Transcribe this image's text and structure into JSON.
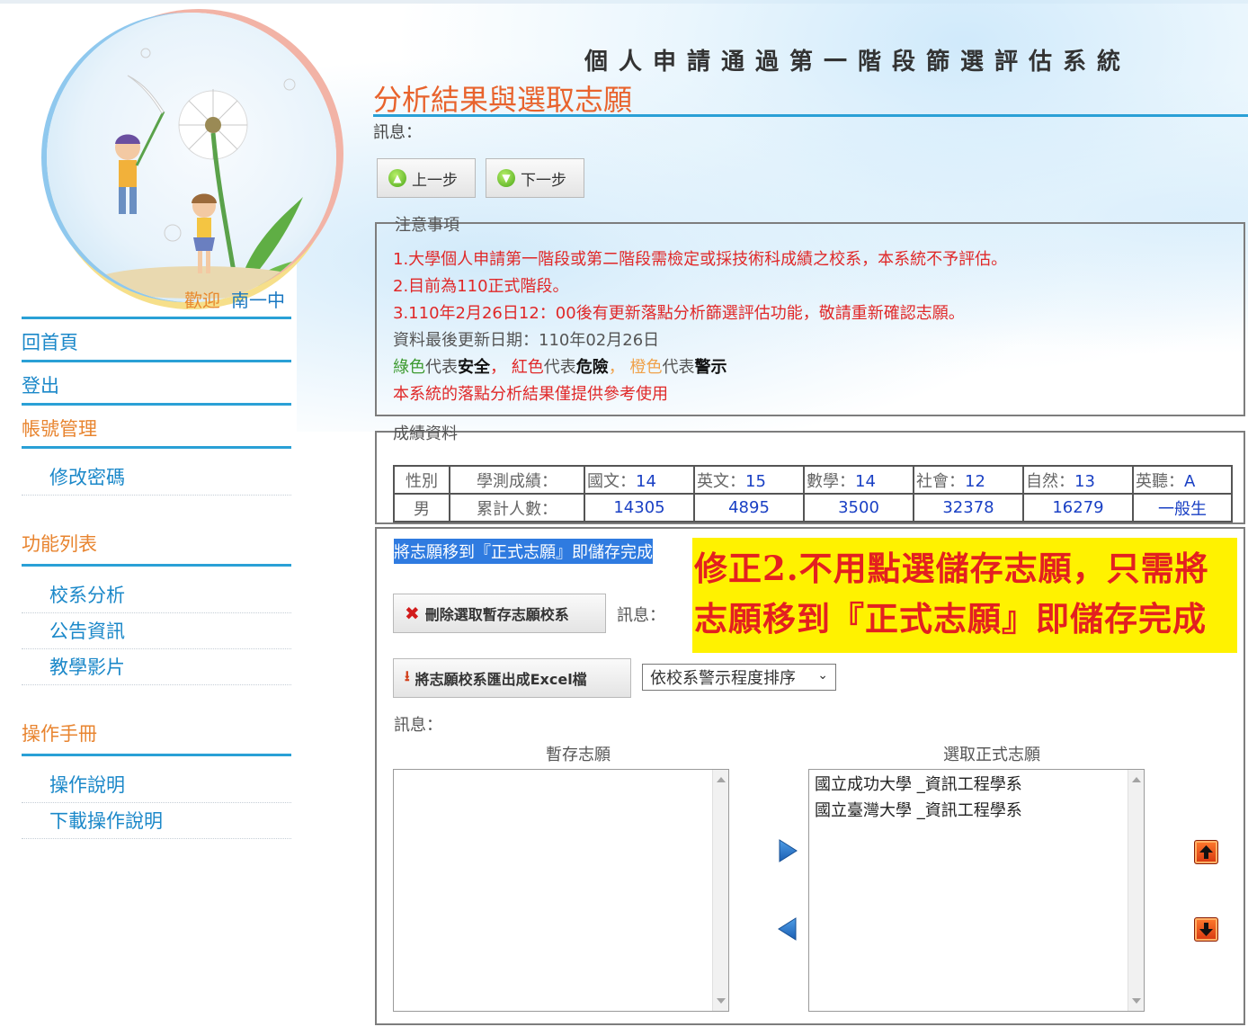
{
  "system_title": "個人申請通過第一階段篩選評估系統",
  "page_title": "分析結果與選取志願",
  "message_label": "訊息：",
  "buttons": {
    "prev": "上一步",
    "next": "下一步"
  },
  "welcome": {
    "prefix": "歡迎",
    "school": "南一中"
  },
  "nav": {
    "home": "回首頁",
    "logout": "登出",
    "account": "帳號管理",
    "change_password": "修改密碼",
    "features": "功能列表",
    "dept_analysis": "校系分析",
    "announcements": "公告資訊",
    "videos": "教學影片",
    "manual": "操作手冊",
    "instructions": "操作說明",
    "download_instructions": "下載操作說明"
  },
  "notes": {
    "legend": "注意事項",
    "line1": "1.大學個人申請第一階段或第二階段需檢定或採技術科成績之校系，本系統不予評估。",
    "line2": "2.目前為110正式階段。",
    "line3": "3.110年2月26日12：00後有更新落點分析篩選評估功能，敬請重新確認志願。",
    "line4": "資料最後更新日期：110年02月26日",
    "legend_green": "綠色",
    "legend_green_txt": "代表",
    "legend_green_word": "安全",
    "sep1": "，",
    "legend_red": "紅色",
    "legend_red_txt": "代表",
    "legend_red_word": "危險",
    "sep2": "，",
    "legend_orange": "橙色",
    "legend_orange_txt": "代表",
    "legend_orange_word": "警示",
    "line6": "本系統的落點分析結果僅提供參考使用"
  },
  "scores": {
    "legend": "成績資料",
    "row1": {
      "gender_label": "性別",
      "exam_label": "學測成績：",
      "chinese_label": "國文：",
      "chinese": "14",
      "english_label": "英文：",
      "english": "15",
      "math_label": "數學：",
      "math": "14",
      "social_label": "社會：",
      "social": "12",
      "science_label": "自然：",
      "science": "13",
      "listening_label": "英聽：",
      "listening": "A"
    },
    "row2": {
      "gender": "男",
      "cum_label": "累計人數：",
      "chinese": "14305",
      "english": "4895",
      "math": "3500",
      "social": "32378",
      "science": "16279",
      "listening": "一般生"
    }
  },
  "lower": {
    "highlight": "將志願移到『正式志願』即儲存完成",
    "notice_line1": "修正2.不用點選儲存志願，只需將",
    "notice_line2": "志願移到『正式志願』即儲存完成",
    "delete_button": "刪除選取暫存志願校系",
    "message_label": "訊息：",
    "export_button": "將志願校系匯出成Excel檔",
    "sort_select": "依校系警示程度排序",
    "message_label2": "訊息：",
    "temp_list_label": "暫存志願",
    "final_list_label": "選取正式志願",
    "final_list": [
      "國立成功大學 _資訊工程學系",
      "國立臺灣大學 _資訊工程學系"
    ]
  },
  "colors": {
    "accent_blue": "#2aa0d6",
    "title_orange": "#e8632d",
    "warn_red": "#e02828",
    "notice_yellow": "#fff200"
  }
}
